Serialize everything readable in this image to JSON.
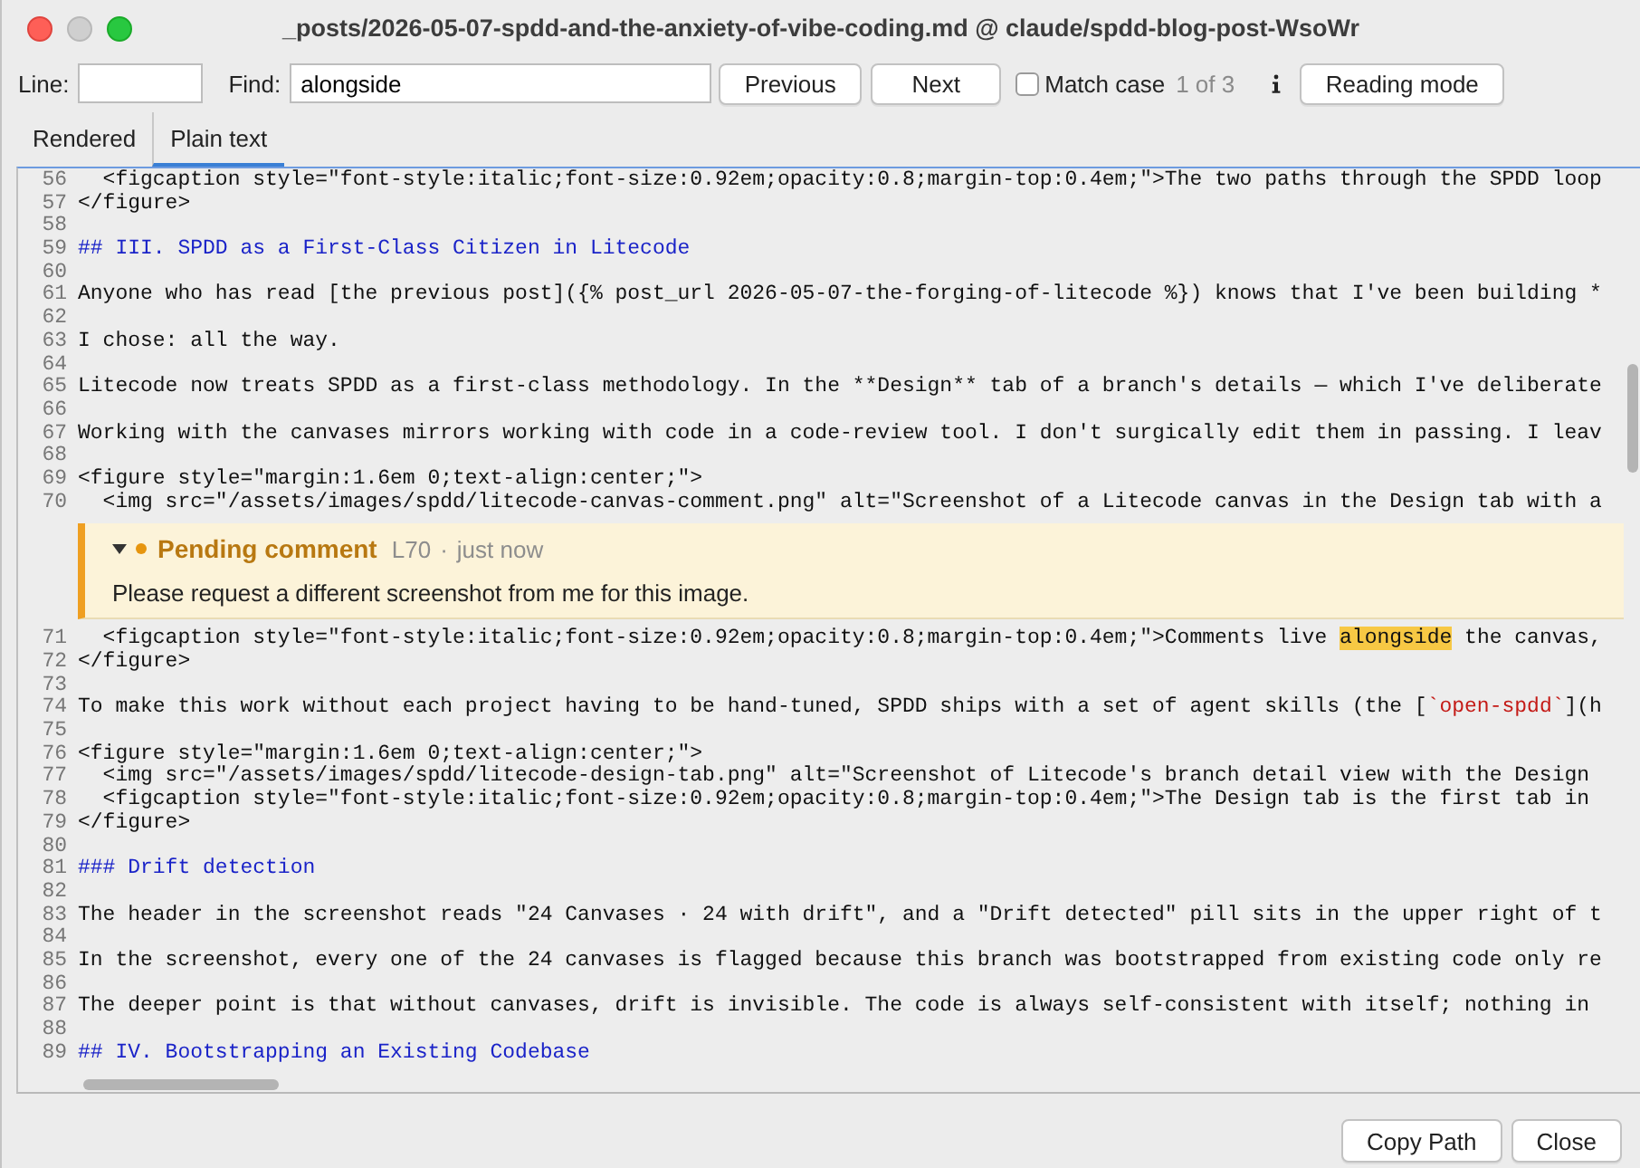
{
  "window": {
    "title": "_posts/2026-05-07-spdd-and-the-anxiety-of-vibe-coding.md @ claude/spdd-blog-post-WsoWr"
  },
  "toolbar": {
    "line_label": "Line:",
    "find_label": "Find:",
    "find_value": "alongside",
    "buttons": [
      "Previous",
      "Next"
    ],
    "match_case": {
      "label": "Match case",
      "checked": false
    },
    "match_count": "1 of 3",
    "reading_mode": "Reading mode"
  },
  "tabs": [
    {
      "label": "Rendered",
      "selected": false
    },
    {
      "label": "Plain text",
      "selected": true
    }
  ],
  "editor": {
    "lines": [
      {
        "kind": "line",
        "number": "56",
        "segments": [
          {
            "kind": "plain",
            "text": "  <figcaption style=\"font-style:italic;font-size:0.92em;opacity:0.8;margin-top:0.4em;\">The two paths through the SPDD loop"
          }
        ]
      },
      {
        "kind": "line",
        "number": "57",
        "segments": [
          {
            "kind": "plain",
            "text": "</figure>"
          }
        ]
      },
      {
        "kind": "line",
        "number": "58"
      },
      {
        "kind": "line",
        "number": "59",
        "segments": [
          {
            "kind": "heading",
            "text": "## III. SPDD as a First-Class Citizen in Litecode"
          }
        ]
      },
      {
        "kind": "line",
        "number": "60"
      },
      {
        "kind": "line",
        "number": "61",
        "segments": [
          {
            "kind": "plain",
            "text": "Anyone who has read [the previous post]({% post_url 2026-05-07-the-forging-of-litecode %}) knows that I've been building *"
          }
        ]
      },
      {
        "kind": "line",
        "number": "62"
      },
      {
        "kind": "line",
        "number": "63",
        "segments": [
          {
            "kind": "plain",
            "text": "I chose: all the way."
          }
        ]
      },
      {
        "kind": "line",
        "number": "64"
      },
      {
        "kind": "line",
        "number": "65",
        "segments": [
          {
            "kind": "plain",
            "text": "Litecode now treats SPDD as a first-class methodology. In the **Design** tab of a branch's details — which I've deliberate"
          }
        ]
      },
      {
        "kind": "line",
        "number": "66"
      },
      {
        "kind": "line",
        "number": "67",
        "segments": [
          {
            "kind": "plain",
            "text": "Working with the canvases mirrors working with code in a code-review tool. I don't surgically edit them in passing. I leav"
          }
        ]
      },
      {
        "kind": "line",
        "number": "68"
      },
      {
        "kind": "line",
        "number": "69",
        "segments": [
          {
            "kind": "plain",
            "text": "<figure style=\"margin:1.6em 0;text-align:center;\">"
          }
        ]
      },
      {
        "kind": "line",
        "number": "70",
        "segments": [
          {
            "kind": "plain",
            "text": "  <img src=\"/assets/images/spdd/litecode-canvas-comment.png\" alt=\"Screenshot of a Litecode canvas in the Design tab with a"
          }
        ]
      },
      {
        "kind": "comment",
        "expanded": true,
        "title": "Pending comment",
        "line_ref": "L70",
        "separator": "·",
        "time": "just now",
        "body": "Please request a different screenshot from me for this image."
      },
      {
        "kind": "line",
        "number": "71",
        "segments": [
          {
            "kind": "plain",
            "text": "  <figcaption style=\"font-style:italic;font-size:0.92em;opacity:0.8;margin-top:0.4em;\">Comments live "
          },
          {
            "kind": "highlight",
            "text": "alongside"
          },
          {
            "kind": "plain",
            "text": " the canvas,"
          }
        ]
      },
      {
        "kind": "line",
        "number": "72",
        "segments": [
          {
            "kind": "plain",
            "text": "</figure>"
          }
        ]
      },
      {
        "kind": "line",
        "number": "73"
      },
      {
        "kind": "line",
        "number": "74",
        "segments": [
          {
            "kind": "plain",
            "text": "To make this work without each project having to be hand-tuned, SPDD ships with a set of agent skills (the ["
          },
          {
            "kind": "code",
            "text": "`open-spdd`"
          },
          {
            "kind": "plain",
            "text": "](h"
          }
        ]
      },
      {
        "kind": "line",
        "number": "75"
      },
      {
        "kind": "line",
        "number": "76",
        "segments": [
          {
            "kind": "plain",
            "text": "<figure style=\"margin:1.6em 0;text-align:center;\">"
          }
        ]
      },
      {
        "kind": "line",
        "number": "77",
        "segments": [
          {
            "kind": "plain",
            "text": "  <img src=\"/assets/images/spdd/litecode-design-tab.png\" alt=\"Screenshot of Litecode's branch detail view with the Design"
          }
        ]
      },
      {
        "kind": "line",
        "number": "78",
        "segments": [
          {
            "kind": "plain",
            "text": "  <figcaption style=\"font-style:italic;font-size:0.92em;opacity:0.8;margin-top:0.4em;\">The Design tab is the first tab in"
          }
        ]
      },
      {
        "kind": "line",
        "number": "79",
        "segments": [
          {
            "kind": "plain",
            "text": "</figure>"
          }
        ]
      },
      {
        "kind": "line",
        "number": "80"
      },
      {
        "kind": "line",
        "number": "81",
        "segments": [
          {
            "kind": "heading",
            "text": "### Drift detection"
          }
        ]
      },
      {
        "kind": "line",
        "number": "82"
      },
      {
        "kind": "line",
        "number": "83",
        "segments": [
          {
            "kind": "plain",
            "text": "The header in the screenshot reads \"24 Canvases · 24 with drift\", and a \"Drift detected\" pill sits in the upper right of t"
          }
        ]
      },
      {
        "kind": "line",
        "number": "84"
      },
      {
        "kind": "line",
        "number": "85",
        "segments": [
          {
            "kind": "plain",
            "text": "In the screenshot, every one of the 24 canvases is flagged because this branch was bootstrapped from existing code only re"
          }
        ]
      },
      {
        "kind": "line",
        "number": "86"
      },
      {
        "kind": "line",
        "number": "87",
        "segments": [
          {
            "kind": "plain",
            "text": "The deeper point is that without canvases, drift is invisible. The code is always self-consistent with itself; nothing in"
          }
        ]
      },
      {
        "kind": "line",
        "number": "88"
      },
      {
        "kind": "line",
        "number": "89",
        "segments": [
          {
            "kind": "heading",
            "text": "## IV. Bootstrapping an Existing Codebase"
          }
        ]
      }
    ]
  },
  "footer": {
    "buttons": [
      "Copy Path",
      "Close"
    ]
  }
}
